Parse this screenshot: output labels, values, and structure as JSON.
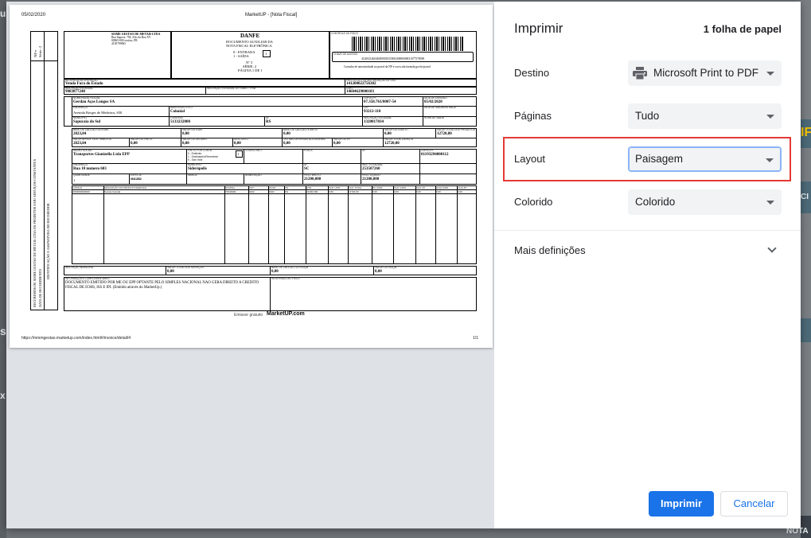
{
  "background": {
    "left_fragments": [
      "u",
      "s",
      "x"
    ],
    "right_fragments": [
      "IF",
      "CI",
      "NOTA"
    ]
  },
  "preview": {
    "date": "05/02/2020",
    "page_title": "MarketUP - [Nota Fiscal]",
    "url": "https://mmmgestao.marketup.com/index.html#/invoice/detail/4",
    "page_number": "1/1",
    "emissor_prefix": "Emissor gratuito",
    "emissor_brand": "MarketUP.com",
    "invoice": {
      "receipt_strip": {
        "nfe": "NF-e",
        "serie": "Série: 2",
        "line1": "RECEBEMOS DE SISME GESTAO DE METAIS LTDA OS PRODUTOS E/OU SERVIÇOS CONSTANTES",
        "line2": "IDENTIFICAÇÃO E ASSINATURA DO RECEBEDOR",
        "line3": "DATA DE RECEBIMENTO"
      },
      "issuer": {
        "name": "SISME GESTAO DE METAIS LTDA",
        "address1": "Rua Itapeva, 794, Alto da Boa XY",
        "address2": "00065-000 socitus, PR",
        "phone": "4130799065"
      },
      "danfe": {
        "title": "DANFE",
        "sub1": "DOCUMENTO AUXILIAR DA",
        "sub2": "NOTA FISCAL ELETRÔNICA",
        "entrada": "0 - ENTRADA",
        "saida": "1 - SAÍDA",
        "type_value": "1",
        "numero": "Nº 3",
        "serie": "SÉRIE: 2",
        "pagina": "PÁGINA 1 DE 1"
      },
      "control": {
        "label": "CONTROLE DO FISCO",
        "chave_label": "CHAVE DE ACESSO",
        "chave": "41200214604629000103550020000000031077378398",
        "consulta": "Consulta de autenticidade no portal da NF-e www.nfe.fazenda.gov.br/portal"
      },
      "operacao": {
        "label": "NATUREZA DA OPERAÇÃO",
        "value": "Venda Fora do Estado"
      },
      "protocolo": {
        "label": "PROTOCOLO DE AUTORIZAÇÃO DE USO",
        "value": "141200022756382"
      },
      "ie": {
        "label": "INSCRIÇÃO ESTADUAL",
        "value": "9083877240"
      },
      "ie_st": {
        "label": "INSCRIÇÃO ESTADUAL DO SUBST. TRIB.",
        "value": ""
      },
      "cnpj": {
        "label": "CNPJ",
        "value": "14604629000103"
      },
      "dest": {
        "nome_label": "NOME/RAZÃO SOCIAL",
        "nome": "Gerdau Aços Longos SA",
        "cnpj_label": "CNPJ/CPF",
        "cnpj": "07.358.761/0007-54",
        "emissao_label": "DATA DE EMISSÃO",
        "emissao": "05/02/2020",
        "endereco_label": "ENDEREÇO",
        "endereco": "Avenida Borges de Medeiros, 650",
        "bairro_label": "BAIRRO/DISTRITO",
        "bairro": "Colonial",
        "cep_label": "CEP",
        "cep": "93212-110",
        "saida_label": "DATA DE SAÍDA/ENTRADA",
        "saida": "",
        "municipio_label": "MUNICÍPIO",
        "municipio": "Sapucaia do Sul",
        "fone_label": "FONE/FAX",
        "fone": "5133232000",
        "uf_label": "UF",
        "uf": "RS",
        "ie_label": "INSCRIÇÃO ESTADUAL",
        "ie": "1320017034",
        "hora_label": "HORA DE SAÍDA",
        "hora": ""
      },
      "tax": {
        "row1": [
          {
            "label": "BASE DE CÁLCULO DO ICMS",
            "value": "2823,84"
          },
          {
            "label": "VALOR DO ICMS",
            "value": "0,00"
          },
          {
            "label": "BASE DE CÁLCULO ICMS ST",
            "value": "0,00"
          },
          {
            "label": "VALOR DO ICMS ST",
            "value": "0,00"
          },
          {
            "label": "VALOR TOTAL DOS PRODUTOS",
            "value": "12720,00"
          }
        ],
        "row2": [
          {
            "label": "VALOR APROX. DOS TRIBUTOS",
            "value": "2823,84"
          },
          {
            "label": "VALOR DO FRETE",
            "value": "0,00"
          },
          {
            "label": "VALOR DO SEGURO",
            "value": "0,00"
          },
          {
            "label": "DESCONTO",
            "value": "0,00"
          },
          {
            "label": "OUTRAS DESPESAS ACESSÓRIAS",
            "value": "0,00"
          },
          {
            "label": "VALOR DO IPI",
            "value": "0,00"
          },
          {
            "label": "VALOR TOTAL DA NOTA",
            "value": "12720,00"
          }
        ]
      },
      "transport": {
        "razao_label": "RAZÃO SOCIAL",
        "razao": "Transportes Gianizella Ltda EPP",
        "frete_label": "FRETE POR CONTA",
        "frete_opts": [
          "0 - Emitente",
          "1 - Destinatário/Remetente",
          "9 - Sem frete"
        ],
        "frete_value": "1",
        "antt_label": "CÓDIGO ANTT",
        "placa_label": "PLACA",
        "uf_label": "UF",
        "cnpj_label": "CNPJ/CPF",
        "cnpj": "01193294000112",
        "end_label": "ENDEREÇO",
        "endereco": "Rua 10 numero 603",
        "mun_label": "MUNICÍPIO",
        "municipio": "Siderópolis",
        "uf2_label": "UF",
        "uf": "SC",
        "ie_label": "INSC. ESTADUAL",
        "ie": "253507260",
        "qtd_label": "QUANTIDADE",
        "qtd": "1",
        "especie_label": "ESPÉCIE",
        "especie": "sucata",
        "marca_label": "MARCA",
        "num_label": "NUMERAÇÃO",
        "pb_label": "PESO BRUTO",
        "pb": "21200,000",
        "pl_label": "PESO LÍQUIDO",
        "pl": "21200,000"
      },
      "items_header": [
        "CÓDIGO",
        "DESCRIÇÃO DO PRODUTO/SERVIÇO",
        "NCM/SH",
        "CST",
        "CFOP",
        "UN",
        "QTD.",
        "VLR. UNIT.",
        "VLR. TOTAL",
        "BC ICMS",
        "VLR. ICMS",
        "VLR. IPI",
        "ALIQ ICMS",
        "ALIQ IPI"
      ],
      "items_row": [
        "2000000000000",
        "Sucata Graúda",
        "72044900",
        "0102",
        "6102",
        "KG",
        "21200,000",
        "0,60",
        "12720,00",
        "0,00",
        "0,00",
        "0,00",
        "0,00",
        "0,00"
      ],
      "issqn": [
        {
          "label": "INSCRIÇÃO MUNICIPAL",
          "value": ""
        },
        {
          "label": "VALOR TOTAL DOS SERVIÇOS",
          "value": "0,00"
        },
        {
          "label": "BASE DE CÁLCULO DO ISSQN",
          "value": "0,00"
        },
        {
          "label": "VALOR DO ISSQN",
          "value": "0,00"
        }
      ],
      "info_label": "INFORMAÇÕES COMPLEMENTARES",
      "info_line1": "DOCUMENTO EMITIDO POR ME OU EPP OPTANTE PELO SIMPLES NACIONAL NAO GERA DIREITO A CREDITO",
      "info_line2": "FISCAL DE ICMS, ISS E IPI. (Emitido através do MarketUp.)",
      "reserved_label": "RESERVADO AO FISCO"
    }
  },
  "panel": {
    "title": "Imprimir",
    "sheet_count": "1 folha de papel",
    "destination_label": "Destino",
    "destination_value": "Microsoft Print to PDF",
    "pages_label": "Páginas",
    "pages_value": "Tudo",
    "layout_label": "Layout",
    "layout_value": "Paisagem",
    "color_label": "Colorido",
    "color_value": "Colorido",
    "more_settings": "Mais definições",
    "print_button": "Imprimir",
    "cancel_button": "Cancelar",
    "accent_color": "#1a73e8",
    "highlight_color": "#e53935"
  }
}
